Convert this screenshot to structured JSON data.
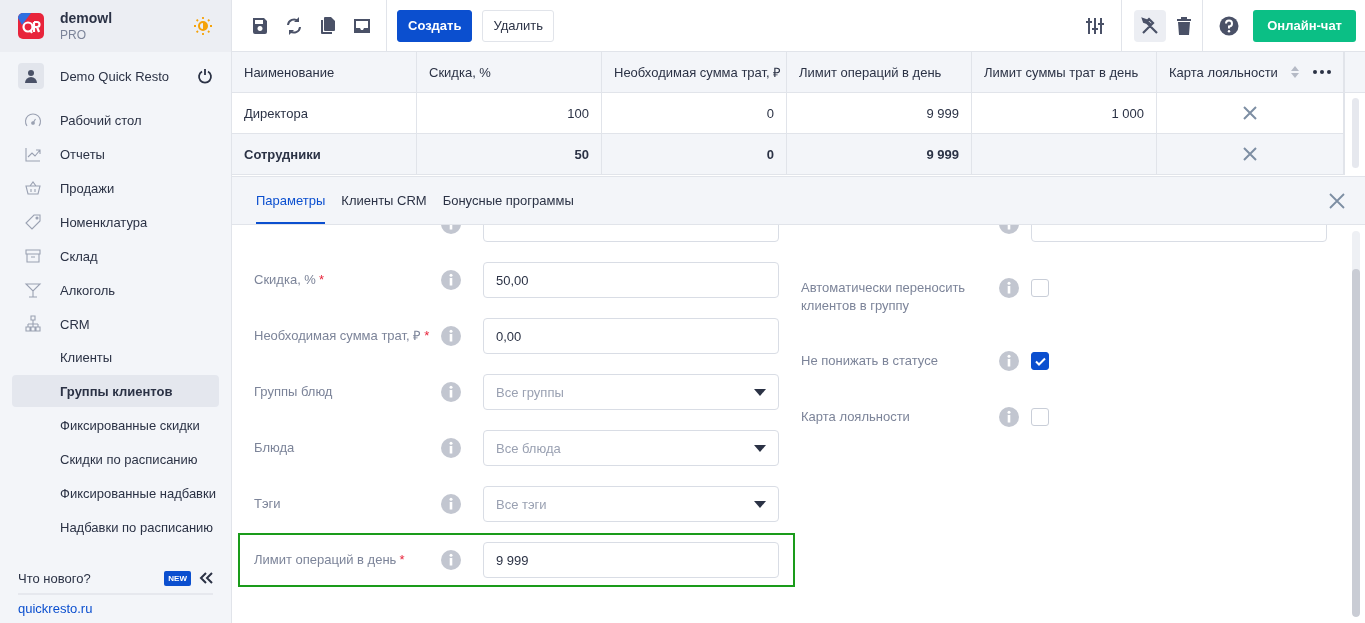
{
  "brand": {
    "name": "demowl",
    "plan": "PRO"
  },
  "user": {
    "name": "Demo Quick Resto"
  },
  "nav": [
    {
      "label": "Рабочий стол",
      "selected": false
    },
    {
      "label": "Отчеты",
      "selected": false
    },
    {
      "label": "Продажи",
      "selected": false
    },
    {
      "label": "Номенклатура",
      "selected": false
    },
    {
      "label": "Склад",
      "selected": false
    },
    {
      "label": "Алкоголь",
      "selected": false
    },
    {
      "label": "CRM",
      "selected": false,
      "children": [
        {
          "label": "Клиенты",
          "selected": false
        },
        {
          "label": "Группы клиентов",
          "selected": true
        },
        {
          "label": "Фиксированные скидки",
          "selected": false
        },
        {
          "label": "Скидки по расписанию",
          "selected": false
        },
        {
          "label": "Фиксированные надбавки",
          "selected": false
        },
        {
          "label": "Надбавки по расписанию",
          "selected": false
        }
      ]
    }
  ],
  "whats_new": {
    "label": "Что нового?",
    "badge": "NEW"
  },
  "site_link": "quickresto.ru",
  "toolbar": {
    "buttons": [
      {
        "label": "Создать",
        "kind": "primary"
      },
      {
        "label": "Удалить",
        "kind": "secondary"
      }
    ],
    "tools_button": {
      "selected": true
    },
    "chat": "Онлайн-чат"
  },
  "table": {
    "columns": [
      "Наименование",
      "Скидка, %",
      "Необходимая сумма трат, ₽",
      "Лимит операций в день",
      "Лимит суммы трат в день",
      "Карта лояльности"
    ],
    "rows": [
      {
        "cells": [
          "Директора",
          "100",
          "0",
          "9 999",
          "1 000"
        ],
        "loyalty_card": false,
        "selected": false
      },
      {
        "cells": [
          "Сотрудники",
          "50",
          "0",
          "9 999"
        ],
        "loyalty_card": false,
        "selected": true
      }
    ]
  },
  "panel": {
    "tabs": [
      {
        "label": "Параметры",
        "selected": true
      },
      {
        "label": "Клиенты CRM",
        "selected": false
      },
      {
        "label": "Бонусные программы",
        "selected": false
      }
    ],
    "left": [
      {
        "kind": "input",
        "highlighted": false
      },
      {
        "label": "Скидка, %",
        "required_mark": "*",
        "kind": "input",
        "value": "50,00",
        "highlighted": false
      },
      {
        "label": "Необходимая сумма трат, ₽",
        "required_mark": "*",
        "kind": "input",
        "value": "0,00",
        "highlighted": false
      },
      {
        "label": "Группы блюд",
        "kind": "select",
        "placeholder": "Все группы",
        "highlighted": false
      },
      {
        "label": "Блюда",
        "kind": "select",
        "placeholder": "Все блюда",
        "highlighted": false
      },
      {
        "label": "Тэги",
        "kind": "select",
        "placeholder": "Все тэги",
        "highlighted": false
      },
      {
        "label": "Лимит операций в день",
        "required_mark": "*",
        "kind": "input",
        "value": "9 999",
        "highlighted": true
      }
    ],
    "right": [
      {
        "kind": "input"
      },
      {
        "label": "Автоматически переносить клиентов в группу",
        "kind": "checkbox",
        "checked": false
      },
      {
        "label": "Не понижать в статусе",
        "kind": "checkbox",
        "checked": true
      },
      {
        "label": "Карта лояльности",
        "kind": "checkbox",
        "checked": false
      }
    ]
  }
}
